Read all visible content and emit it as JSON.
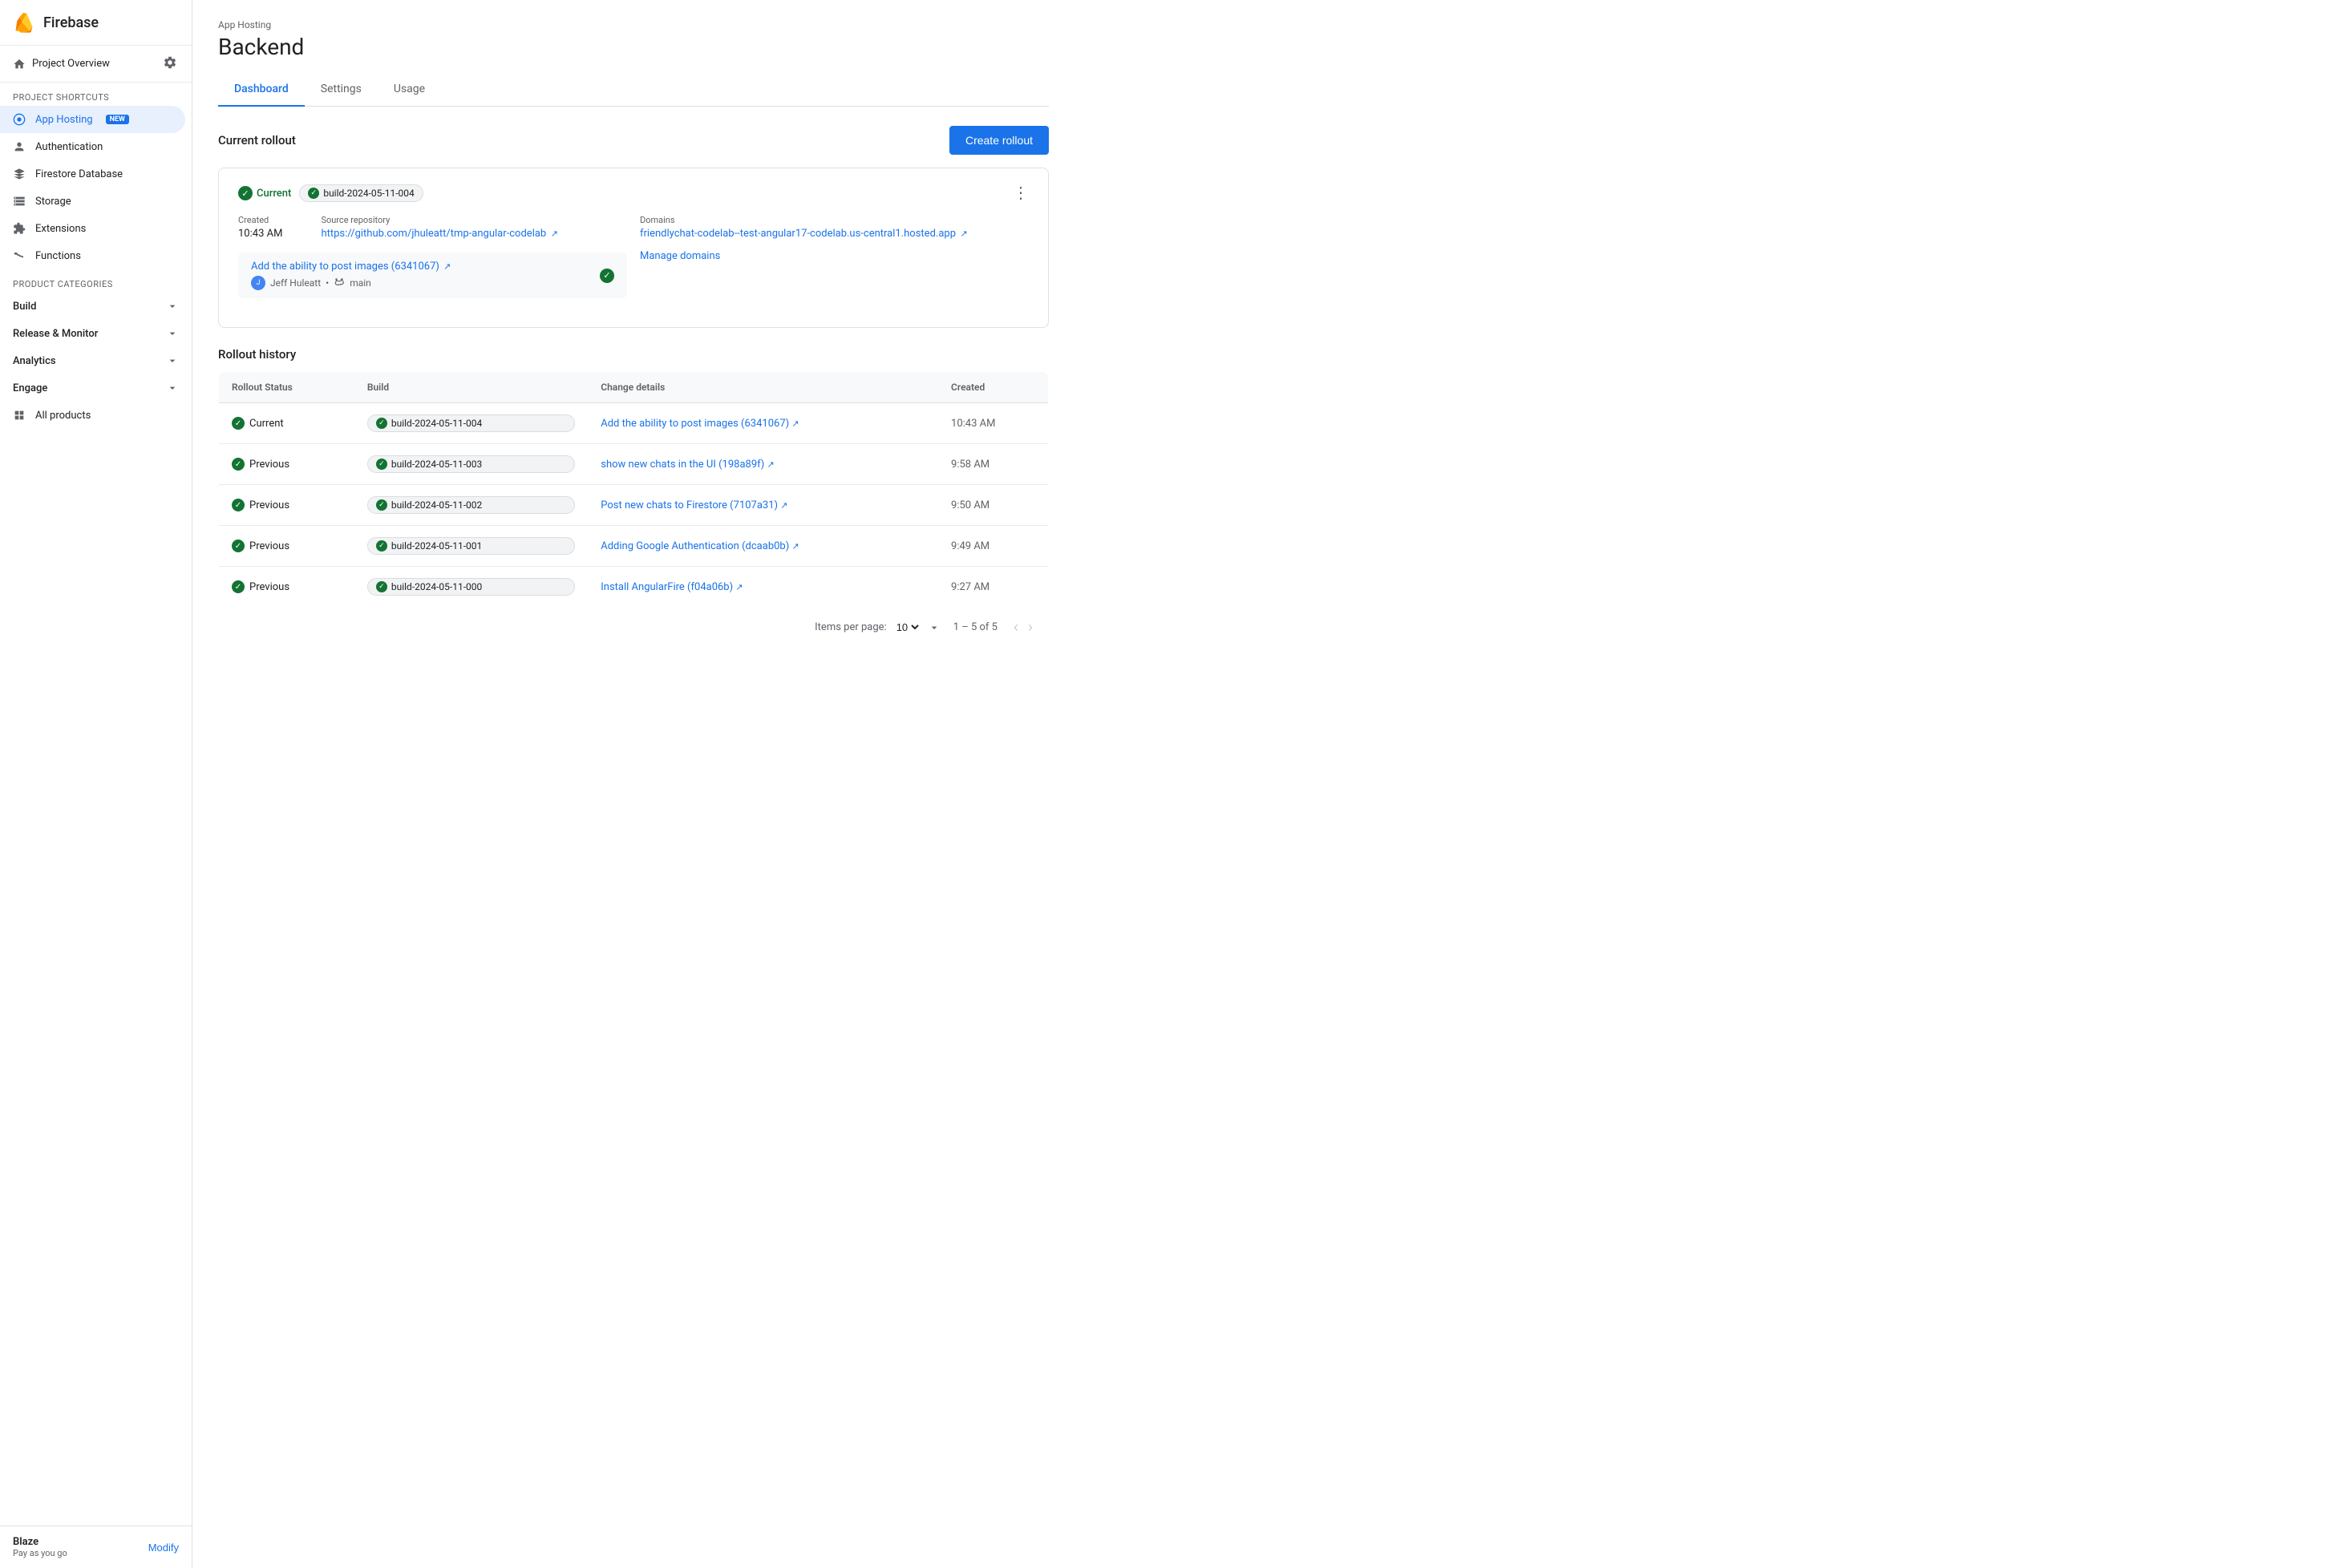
{
  "sidebar": {
    "app_name": "Firebase",
    "project_overview": "Project Overview",
    "project_shortcuts_label": "Project shortcuts",
    "nav_items": [
      {
        "id": "app-hosting",
        "label": "App Hosting",
        "badge": "NEW",
        "active": true,
        "icon": "◉"
      },
      {
        "id": "authentication",
        "label": "Authentication",
        "active": false,
        "icon": "👤"
      },
      {
        "id": "firestore",
        "label": "Firestore Database",
        "active": false,
        "icon": "🔥"
      },
      {
        "id": "storage",
        "label": "Storage",
        "active": false,
        "icon": "📦"
      },
      {
        "id": "extensions",
        "label": "Extensions",
        "active": false,
        "icon": "🔌"
      },
      {
        "id": "functions",
        "label": "Functions",
        "active": false,
        "icon": "{ }"
      }
    ],
    "product_categories_label": "Product categories",
    "categories": [
      {
        "id": "build",
        "label": "Build"
      },
      {
        "id": "release-monitor",
        "label": "Release & Monitor"
      },
      {
        "id": "analytics",
        "label": "Analytics"
      },
      {
        "id": "engage",
        "label": "Engage"
      }
    ],
    "all_products": "All products",
    "footer": {
      "plan": "Blaze",
      "subtitle": "Pay as you go",
      "modify_label": "Modify"
    }
  },
  "header": {
    "breadcrumb": "App Hosting",
    "title": "Backend"
  },
  "tabs": [
    {
      "id": "dashboard",
      "label": "Dashboard",
      "active": true
    },
    {
      "id": "settings",
      "label": "Settings",
      "active": false
    },
    {
      "id": "usage",
      "label": "Usage",
      "active": false
    }
  ],
  "current_rollout": {
    "section_title": "Current rollout",
    "create_button": "Create rollout",
    "status": "Current",
    "build_id": "build-2024-05-11-004",
    "created_label": "Created",
    "created_value": "10:43 AM",
    "source_repo_label": "Source repository",
    "source_repo_url": "https://github.com/jhuleatt/tmp-angular-codelab",
    "domains_label": "Domains",
    "domain_url": "friendlychat-codelab--test-angular17-codelab.us-central1.hosted.app",
    "manage_domains": "Manage domains",
    "commit_link_text": "Add the ability to post images (6341067)",
    "commit_author": "Jeff Huleatt",
    "commit_branch": "main"
  },
  "rollout_history": {
    "section_title": "Rollout history",
    "columns": [
      "Rollout Status",
      "Build",
      "Change details",
      "Created"
    ],
    "rows": [
      {
        "status": "Current",
        "build": "build-2024-05-11-004",
        "change": "Add the ability to post images (6341067)",
        "created": "10:43 AM"
      },
      {
        "status": "Previous",
        "build": "build-2024-05-11-003",
        "change": "show new chats in the UI (198a89f)",
        "created": "9:58 AM"
      },
      {
        "status": "Previous",
        "build": "build-2024-05-11-002",
        "change": "Post new chats to Firestore (7107a31)",
        "created": "9:50 AM"
      },
      {
        "status": "Previous",
        "build": "build-2024-05-11-001",
        "change": "Adding Google Authentication (dcaab0b)",
        "created": "9:49 AM"
      },
      {
        "status": "Previous",
        "build": "build-2024-05-11-000",
        "change": "Install AngularFire (f04a06b)",
        "created": "9:27 AM"
      }
    ],
    "pagination": {
      "items_per_page_label": "Items per page:",
      "items_per_page_value": "10",
      "range": "1 – 5 of 5"
    }
  }
}
